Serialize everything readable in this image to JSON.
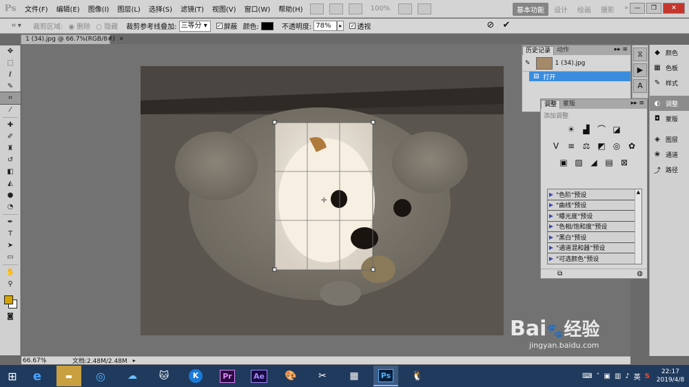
{
  "app": {
    "logo": "Ps"
  },
  "menu": [
    "文件(F)",
    "编辑(E)",
    "图像(I)",
    "图层(L)",
    "选择(S)",
    "滤镜(T)",
    "视图(V)",
    "窗口(W)",
    "帮助(H)"
  ],
  "menubar_zoom": "100%",
  "workspaces": [
    {
      "label": "基本功能",
      "active": true
    },
    {
      "label": "设计",
      "active": false
    },
    {
      "label": "绘画",
      "active": false
    },
    {
      "label": "摄影",
      "active": false
    }
  ],
  "options": {
    "crop_area_label": "裁剪区域:",
    "delete_label": "删除",
    "hide_label": "隐藏",
    "overlay_label": "裁剪参考线叠加:",
    "overlay_value": "三等分",
    "shield_label": "屏蔽",
    "color_label": "颜色:",
    "shield_color": "#000000",
    "opacity_label": "不透明度:",
    "opacity_value": "78%",
    "perspective_label": "透视"
  },
  "document": {
    "tab_title": "1 (34).jpg @ 66.7%(RGB/8#)"
  },
  "status": {
    "zoom": "66.67%",
    "doc_info": "文档:2.48M/2.48M"
  },
  "history_panel": {
    "tabs": [
      "历史记录",
      "动作"
    ],
    "snapshot": "1 (34).jpg",
    "steps": [
      "打开"
    ]
  },
  "adjust_panel": {
    "tabs": [
      "调整",
      "蒙版"
    ],
    "subtitle": "添加调整",
    "presets": [
      "\"色阶\"预设",
      "\"曲线\"预设",
      "\"曝光度\"预设",
      "\"色相/饱和度\"预设",
      "\"黑白\"预设",
      "\"通道混和器\"预设",
      "\"可选颜色\"预设"
    ]
  },
  "right_dock": {
    "group1": [
      {
        "icon": "color-icon",
        "label": "颜色",
        "active": false
      },
      {
        "icon": "swatches-icon",
        "label": "色板",
        "active": false
      },
      {
        "icon": "styles-icon",
        "label": "样式",
        "active": false
      }
    ],
    "group2": [
      {
        "icon": "adjustments-icon",
        "label": "调整",
        "active": true
      },
      {
        "icon": "masks-icon",
        "label": "蒙版",
        "active": false
      }
    ],
    "group3": [
      {
        "icon": "layers-icon",
        "label": "图层",
        "active": false
      },
      {
        "icon": "channels-icon",
        "label": "通道",
        "active": false
      },
      {
        "icon": "paths-icon",
        "label": "路径",
        "active": false
      }
    ]
  },
  "taskbar": {
    "apps": [
      "e",
      "Folder",
      "Browser",
      "Baidu",
      "Cat",
      "K",
      "Pr",
      "Ae",
      "Paint",
      "Tool",
      "Calc",
      "Ps",
      "QQ"
    ],
    "tray_lang": "英",
    "time": "22:17",
    "date": "2019/4/8"
  },
  "watermark": {
    "brand": "Bai",
    "brand2": "经验",
    "url": "jingyan.baidu.com"
  },
  "colors": {
    "foreground": "#d4a300",
    "background": "#ffffff",
    "accent": "#3a8dde"
  }
}
